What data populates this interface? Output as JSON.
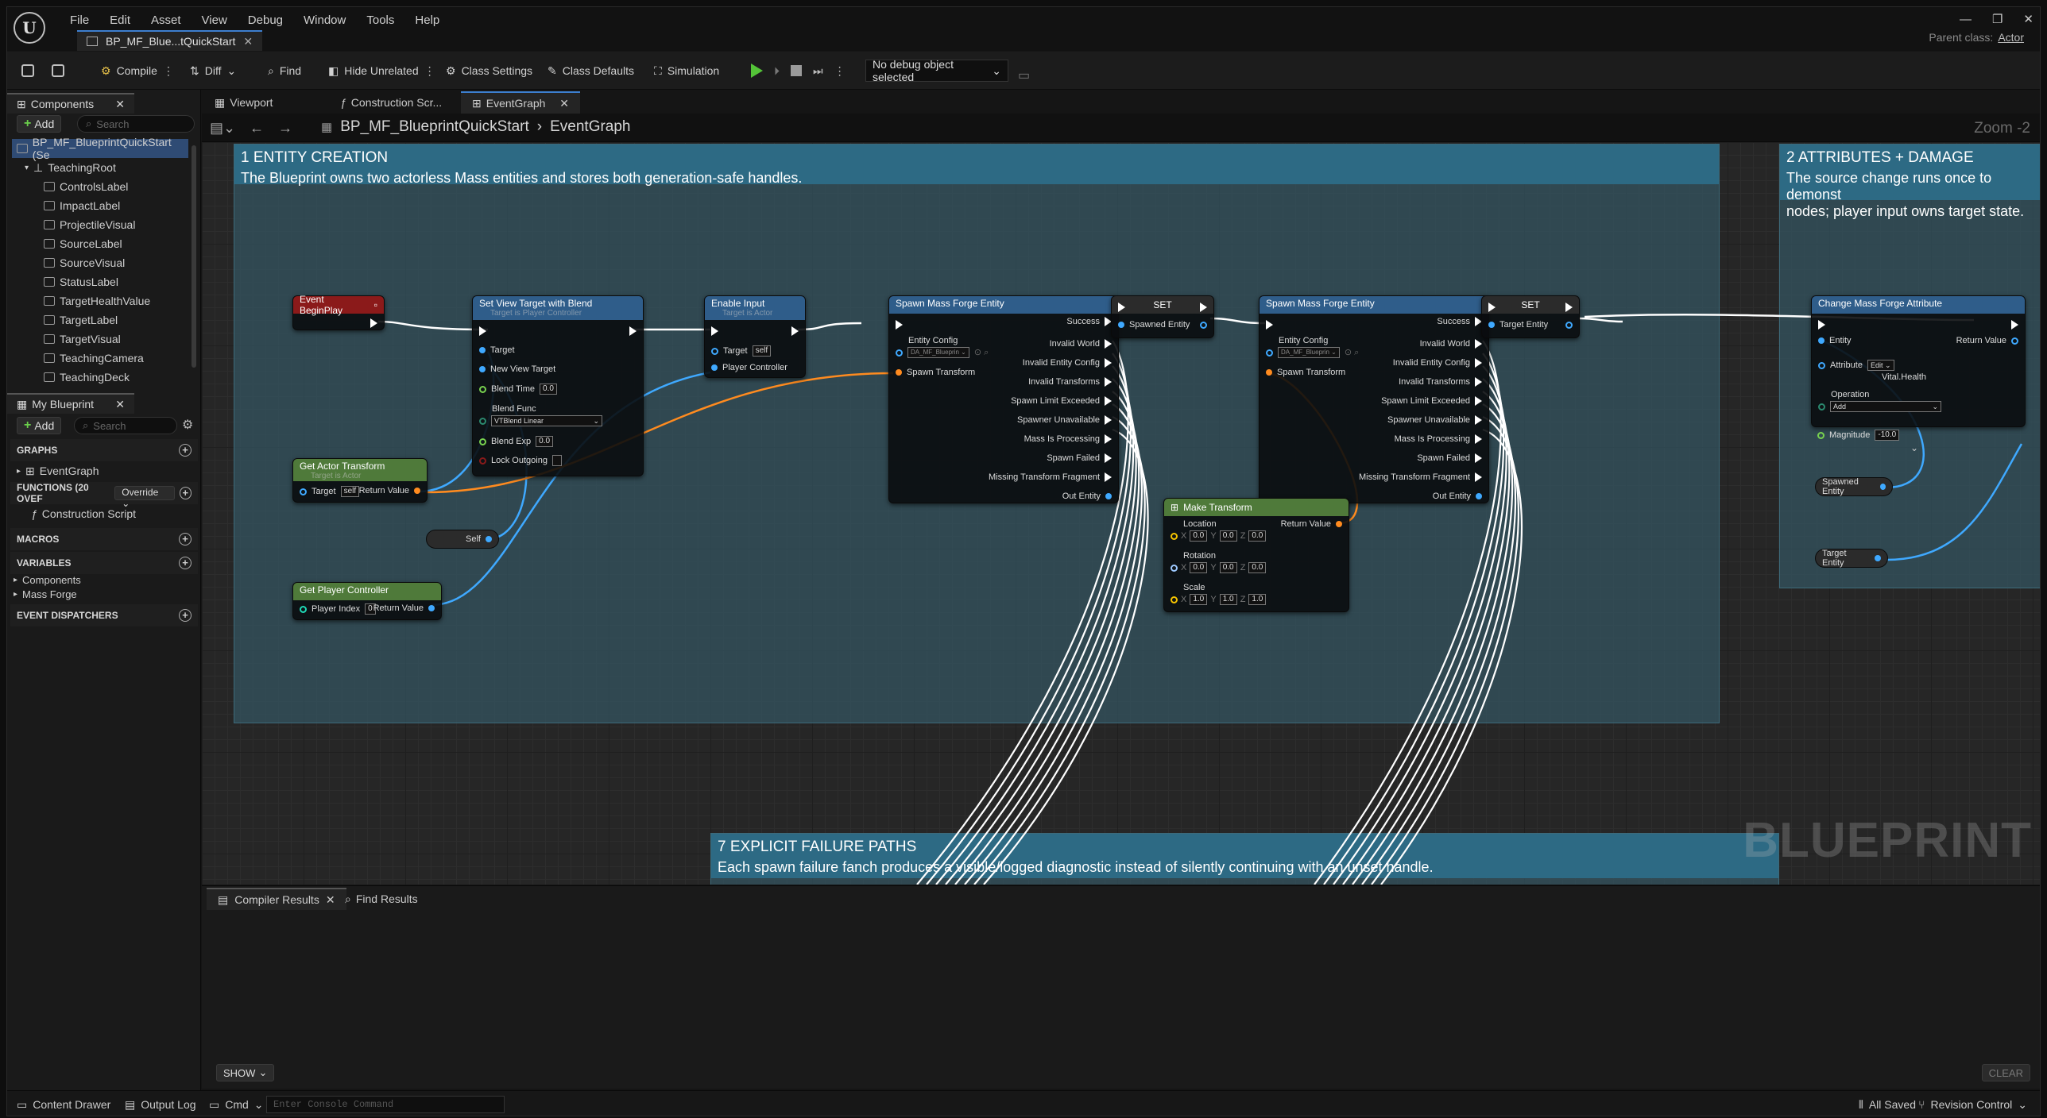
{
  "app": {
    "logo": "U",
    "menu": [
      "File",
      "Edit",
      "Asset",
      "View",
      "Debug",
      "Window",
      "Tools",
      "Help"
    ],
    "tab": "BP_MF_Blue...tQuickStart",
    "parent_class_label": "Parent class:",
    "parent_class": "Actor"
  },
  "toolbar": {
    "compile": "Compile",
    "diff": "Diff",
    "find": "Find",
    "hide_unrelated": "Hide Unrelated",
    "class_settings": "Class Settings",
    "class_defaults": "Class Defaults",
    "simulation": "Simulation",
    "debug_object": "No debug object selected"
  },
  "components": {
    "tab": "Components",
    "add": "Add",
    "search": "Search",
    "root": "BP_MF_BlueprintQuickStart (Se",
    "teaching_root": "TeachingRoot",
    "items": [
      "ControlsLabel",
      "ImpactLabel",
      "ProjectileVisual",
      "SourceLabel",
      "SourceVisual",
      "StatusLabel",
      "TargetHealthValue",
      "TargetLabel",
      "TargetVisual",
      "TeachingCamera",
      "TeachingDeck"
    ]
  },
  "myblueprint": {
    "tab": "My Blueprint",
    "add": "Add",
    "search": "Search",
    "graphs": "GRAPHS",
    "eventgraph": "EventGraph",
    "functions": "FUNCTIONS (20 OVEF",
    "override": "Override",
    "construction": "Construction Script",
    "macros": "MACROS",
    "variables": "VARIABLES",
    "var_items": [
      "Components",
      "Mass Forge"
    ],
    "dispatchers": "EVENT DISPATCHERS"
  },
  "graph_tabs": [
    "Viewport",
    "Construction Scr...",
    "EventGraph"
  ],
  "crumb": {
    "bp": "BP_MF_BlueprintQuickStart",
    "graph": "EventGraph",
    "zoom": "Zoom -2"
  },
  "comments": {
    "c1_title": "1  ENTITY CREATION",
    "c1_desc": "The Blueprint owns two actorless Mass entities and stores both generation-safe handles.",
    "c2_title": "2  ATTRIBUTES + DAMAGE",
    "c2_desc1": "The source change runs once to demonst",
    "c2_desc2": "nodes; player input owns target state.",
    "c7_title": "7  EXPLICIT FAILURE PATHS",
    "c7_desc": "Each spawn failure fanch produces a visible/logged diagnostic instead of silently continuing with an unset handle."
  },
  "nodes": {
    "begin_play": "Event BeginPlay",
    "set_view": {
      "title": "Set View Target with Blend",
      "sub": "Target is Player Controller",
      "target": "Target",
      "new_view": "New View Target",
      "blend_time": "Blend Time",
      "blend_time_v": "0.0",
      "blend_func": "Blend Func",
      "blend_func_v": "VTBlend Linear",
      "blend_exp": "Blend Exp",
      "blend_exp_v": "0.0",
      "lock": "Lock Outgoing"
    },
    "enable_input": {
      "title": "Enable Input",
      "sub": "Target is Actor",
      "target": "Target",
      "target_v": "self",
      "pc": "Player Controller"
    },
    "get_actor_transform": {
      "title": "Get Actor Transform",
      "sub": "Target is Actor",
      "target": "Target",
      "target_v": "self",
      "ret": "Return Value"
    },
    "self": "Self",
    "get_pc": {
      "title": "Get Player Controller",
      "pi": "Player Index",
      "pi_v": "0",
      "ret": "Return Value"
    },
    "spawn": {
      "title": "Spawn Mass Forge Entity",
      "success": "Success",
      "entity_config": "Entity Config",
      "config_v": "DA_MF_Blueprin",
      "spawn_transform": "Spawn Transform",
      "outs": [
        "Invalid World",
        "Invalid Entity Config",
        "Invalid Transforms",
        "Spawn Limit Exceeded",
        "Spawner Unavailable",
        "Mass Is Processing",
        "Spawn Failed",
        "Missing Transform Fragment",
        "Out Entity"
      ]
    },
    "set1": {
      "title": "SET",
      "pin": "Spawned Entity"
    },
    "set2": {
      "title": "SET",
      "pin": "Target Entity"
    },
    "make_transform": {
      "title": "Make Transform",
      "location": "Location",
      "rotation": "Rotation",
      "scale": "Scale",
      "ret": "Return Value",
      "zero": "0.0",
      "one": "1.0",
      "x": "X",
      "y": "Y",
      "z": "Z"
    },
    "change_attr": {
      "title": "Change Mass Forge Attribute",
      "entity": "Entity",
      "ret": "Return Value",
      "attribute": "Attribute",
      "attr_edit": "Edit",
      "attr_v": "Vital.Health",
      "operation": "Operation",
      "op_v": "Add",
      "magnitude": "Magnitude",
      "mag_v": "-10.0"
    },
    "var_spawned": "Spawned Entity",
    "var_target": "Target Entity"
  },
  "watermark": "BLUEPRINT",
  "bottom": {
    "compiler_tab": "Compiler Results",
    "find_tab": "Find Results",
    "show": "SHOW",
    "clear": "CLEAR"
  },
  "status": {
    "content_drawer": "Content Drawer",
    "output_log": "Output Log",
    "cmd": "Cmd",
    "console_ph": "Enter Console Command",
    "all_saved": "All Saved",
    "revision": "Revision Control"
  },
  "colors": {
    "accent": "#3d7fcf",
    "comment_header": "#2d6a84",
    "exec_pin": "#ffffff",
    "object_pin": "#3fa9ff",
    "struct_pin": "#ff8b1f",
    "float_pin": "#78d24f",
    "event_header": "#8b1a1a",
    "function_header": "#2f5d8a",
    "pure_header": "#4f7a3a"
  }
}
